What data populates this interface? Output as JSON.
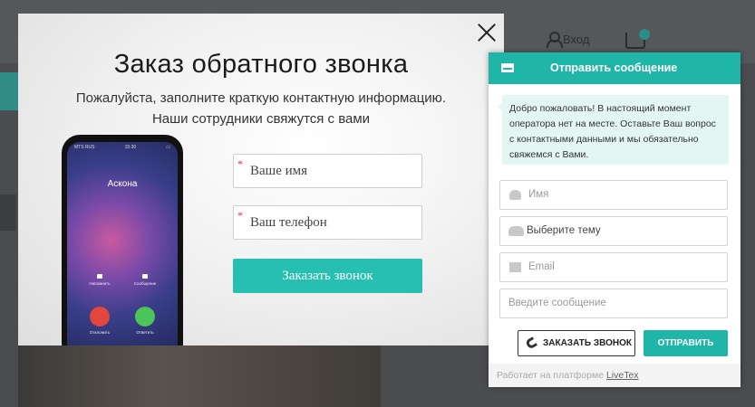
{
  "site_header": {
    "account_label": "Вход"
  },
  "callback_modal": {
    "title": "Заказ обратного звонка",
    "subtitle_line1": "Пожалуйста, заполните краткую контактную информацию.",
    "subtitle_line2": "Наши сотрудники свяжутся с вами",
    "name_placeholder": "Ваше имя",
    "phone_placeholder": "Ваш телефон",
    "required_mark": "*",
    "submit_label": "Заказать звонок",
    "phone_screen": {
      "carrier": "MTS RUS",
      "time": "15:30",
      "caller": "Аскона",
      "remind_label": "Напомнить",
      "message_label": "Сообщение",
      "decline_label": "Отклонить",
      "accept_label": "Ответить"
    }
  },
  "chat_widget": {
    "header_title": "Отправить сообщение",
    "greeting": "Добро пожаловать! В настоящий момент оператора нет на месте. Оставьте Ваш вопрос с контактными данными и мы обязательно свяжемся с Вами.",
    "name_placeholder": "Имя",
    "topic_value": "Выберите тему",
    "email_placeholder": "Email",
    "message_placeholder": "Введите сообщение",
    "call_button": "ЗАКАЗАТЬ ЗВОНОК",
    "send_button": "ОТПРАВИТЬ",
    "footer_text": "Работает на платформе",
    "footer_link": "LiveTex"
  },
  "colors": {
    "accent": "#27bfb1",
    "chat_accent": "#1fb6a8",
    "decline": "#e2463d",
    "accept": "#4cc45a"
  }
}
